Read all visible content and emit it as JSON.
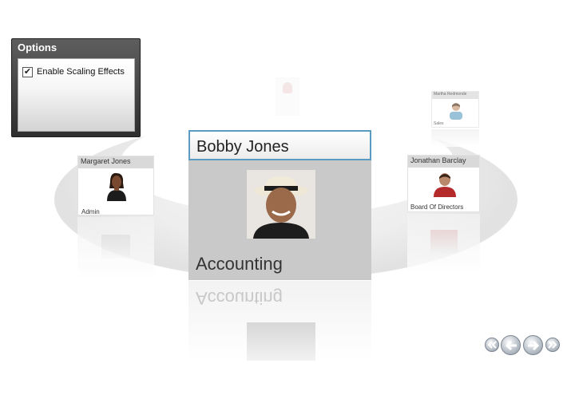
{
  "options": {
    "title": "Options",
    "checkbox_label": "Enable Scaling Effects",
    "checkbox_checked": true,
    "check_glyph": "✔"
  },
  "carousel": {
    "selected": {
      "name": "Bobby Jones",
      "department": "Accounting"
    },
    "left_card": {
      "name": "Margaret Jones",
      "department": "Admin"
    },
    "right_card": {
      "name": "Jonathan Barclay",
      "department": "Board Of Directors"
    },
    "back_right_card": {
      "name": "Martha Redmonde",
      "department": "Sales"
    }
  },
  "navigation": {
    "first_icon": "double-chevron-left",
    "prev_icon": "arrow-left",
    "next_icon": "arrow-right",
    "last_icon": "double-chevron-right"
  }
}
